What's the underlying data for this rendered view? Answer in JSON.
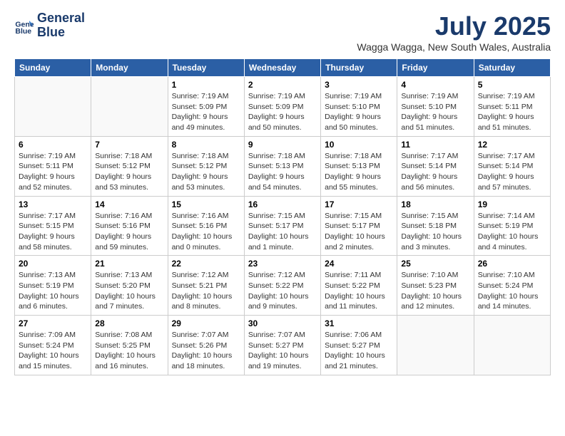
{
  "logo": {
    "line1": "General",
    "line2": "Blue"
  },
  "title": "July 2025",
  "subtitle": "Wagga Wagga, New South Wales, Australia",
  "days_of_week": [
    "Sunday",
    "Monday",
    "Tuesday",
    "Wednesday",
    "Thursday",
    "Friday",
    "Saturday"
  ],
  "weeks": [
    [
      {
        "day": "",
        "detail": ""
      },
      {
        "day": "",
        "detail": ""
      },
      {
        "day": "1",
        "detail": "Sunrise: 7:19 AM\nSunset: 5:09 PM\nDaylight: 9 hours\nand 49 minutes."
      },
      {
        "day": "2",
        "detail": "Sunrise: 7:19 AM\nSunset: 5:09 PM\nDaylight: 9 hours\nand 50 minutes."
      },
      {
        "day": "3",
        "detail": "Sunrise: 7:19 AM\nSunset: 5:10 PM\nDaylight: 9 hours\nand 50 minutes."
      },
      {
        "day": "4",
        "detail": "Sunrise: 7:19 AM\nSunset: 5:10 PM\nDaylight: 9 hours\nand 51 minutes."
      },
      {
        "day": "5",
        "detail": "Sunrise: 7:19 AM\nSunset: 5:11 PM\nDaylight: 9 hours\nand 51 minutes."
      }
    ],
    [
      {
        "day": "6",
        "detail": "Sunrise: 7:19 AM\nSunset: 5:11 PM\nDaylight: 9 hours\nand 52 minutes."
      },
      {
        "day": "7",
        "detail": "Sunrise: 7:18 AM\nSunset: 5:12 PM\nDaylight: 9 hours\nand 53 minutes."
      },
      {
        "day": "8",
        "detail": "Sunrise: 7:18 AM\nSunset: 5:12 PM\nDaylight: 9 hours\nand 53 minutes."
      },
      {
        "day": "9",
        "detail": "Sunrise: 7:18 AM\nSunset: 5:13 PM\nDaylight: 9 hours\nand 54 minutes."
      },
      {
        "day": "10",
        "detail": "Sunrise: 7:18 AM\nSunset: 5:13 PM\nDaylight: 9 hours\nand 55 minutes."
      },
      {
        "day": "11",
        "detail": "Sunrise: 7:17 AM\nSunset: 5:14 PM\nDaylight: 9 hours\nand 56 minutes."
      },
      {
        "day": "12",
        "detail": "Sunrise: 7:17 AM\nSunset: 5:14 PM\nDaylight: 9 hours\nand 57 minutes."
      }
    ],
    [
      {
        "day": "13",
        "detail": "Sunrise: 7:17 AM\nSunset: 5:15 PM\nDaylight: 9 hours\nand 58 minutes."
      },
      {
        "day": "14",
        "detail": "Sunrise: 7:16 AM\nSunset: 5:16 PM\nDaylight: 9 hours\nand 59 minutes."
      },
      {
        "day": "15",
        "detail": "Sunrise: 7:16 AM\nSunset: 5:16 PM\nDaylight: 10 hours\nand 0 minutes."
      },
      {
        "day": "16",
        "detail": "Sunrise: 7:15 AM\nSunset: 5:17 PM\nDaylight: 10 hours\nand 1 minute."
      },
      {
        "day": "17",
        "detail": "Sunrise: 7:15 AM\nSunset: 5:17 PM\nDaylight: 10 hours\nand 2 minutes."
      },
      {
        "day": "18",
        "detail": "Sunrise: 7:15 AM\nSunset: 5:18 PM\nDaylight: 10 hours\nand 3 minutes."
      },
      {
        "day": "19",
        "detail": "Sunrise: 7:14 AM\nSunset: 5:19 PM\nDaylight: 10 hours\nand 4 minutes."
      }
    ],
    [
      {
        "day": "20",
        "detail": "Sunrise: 7:13 AM\nSunset: 5:19 PM\nDaylight: 10 hours\nand 6 minutes."
      },
      {
        "day": "21",
        "detail": "Sunrise: 7:13 AM\nSunset: 5:20 PM\nDaylight: 10 hours\nand 7 minutes."
      },
      {
        "day": "22",
        "detail": "Sunrise: 7:12 AM\nSunset: 5:21 PM\nDaylight: 10 hours\nand 8 minutes."
      },
      {
        "day": "23",
        "detail": "Sunrise: 7:12 AM\nSunset: 5:22 PM\nDaylight: 10 hours\nand 9 minutes."
      },
      {
        "day": "24",
        "detail": "Sunrise: 7:11 AM\nSunset: 5:22 PM\nDaylight: 10 hours\nand 11 minutes."
      },
      {
        "day": "25",
        "detail": "Sunrise: 7:10 AM\nSunset: 5:23 PM\nDaylight: 10 hours\nand 12 minutes."
      },
      {
        "day": "26",
        "detail": "Sunrise: 7:10 AM\nSunset: 5:24 PM\nDaylight: 10 hours\nand 14 minutes."
      }
    ],
    [
      {
        "day": "27",
        "detail": "Sunrise: 7:09 AM\nSunset: 5:24 PM\nDaylight: 10 hours\nand 15 minutes."
      },
      {
        "day": "28",
        "detail": "Sunrise: 7:08 AM\nSunset: 5:25 PM\nDaylight: 10 hours\nand 16 minutes."
      },
      {
        "day": "29",
        "detail": "Sunrise: 7:07 AM\nSunset: 5:26 PM\nDaylight: 10 hours\nand 18 minutes."
      },
      {
        "day": "30",
        "detail": "Sunrise: 7:07 AM\nSunset: 5:27 PM\nDaylight: 10 hours\nand 19 minutes."
      },
      {
        "day": "31",
        "detail": "Sunrise: 7:06 AM\nSunset: 5:27 PM\nDaylight: 10 hours\nand 21 minutes."
      },
      {
        "day": "",
        "detail": ""
      },
      {
        "day": "",
        "detail": ""
      }
    ]
  ]
}
